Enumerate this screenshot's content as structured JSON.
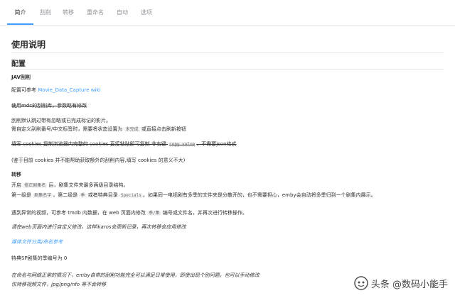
{
  "tabs": [
    {
      "label": "简介",
      "active": true
    },
    {
      "label": "刮削",
      "active": false
    },
    {
      "label": "转移",
      "active": false
    },
    {
      "label": "重命名",
      "active": false
    },
    {
      "label": "自动",
      "active": false
    },
    {
      "label": "选项",
      "active": false
    }
  ],
  "doc": {
    "title": "使用说明",
    "section": "配置",
    "jav_heading": "JAV刮削",
    "jav_config_prefix": "配置可参考 ",
    "jav_config_link": "Movie_Data_Capture wiki",
    "strike_line1": "使用mdc的刮削库，参数略有修改",
    "line_default": "刮削默认跳过带有忽略或已完成标记的影片。",
    "line_custom_a": "需自定义刮削番号/中文标签时，需要将状态设置为",
    "line_custom_code": "未完成",
    "line_custom_b": "或直接点击刷新按钮",
    "strike_cookie_a": "填写 cookies 复制浏览器内完整的 cookies 直接粘贴即可复制 非右键",
    "strike_cookie_code": "copy value",
    "strike_cookie_b": "，不需要json格式",
    "cookie_note": "(鉴于目前 cookies 并不能帮助获取额外的刮削内容,填写 cookies 的意义不大)",
    "transfer_heading": "转移",
    "transfer_a1": "开启",
    "transfer_a_code": "修正剧集名",
    "transfer_a2": "后，剧集文件夹最多两级目录结构。",
    "transfer_b1": "第一级是",
    "transfer_b_code1": "剧集名字",
    "transfer_b2": "，第二级是",
    "transfer_b_code2": "季",
    "transfer_b3": "或者特典目录",
    "transfer_b_code3": "Specials",
    "transfer_b4": "。如果同一电视剧有多季的文件夹是分散开的，也不需要担心，emby会自动将多季归到一个剧集内展示。",
    "abnormal_a": "遇到异常的视频，可参考 tmdb 内数据，在 web 页面内修改",
    "abnormal_code": "季/集",
    "abnormal_b": "编号或文件名，并再次进行转移操作。",
    "italic_custom": "请在web页面内进行自定义修改，这样ikaros会更新记录，再次转移会应用修改",
    "italic_link": "媒体文件分类/命名参考",
    "sp_line": "特典SP剧集的季编号为 0",
    "italic_rename1": "在命名与网络正常的情况下，emby自带的刮削功能完全可以满足日常使用，即使出现个别问题，也可以手动修改",
    "italic_rename2": "仅转移视频文件，jpg/png/nfo 等不会转移"
  },
  "watermark": {
    "text": "头条 @数码小能手"
  },
  "colors": {
    "accent": "#409eff",
    "text": "#303133",
    "muted": "#909399",
    "border": "#e4e7ed"
  }
}
